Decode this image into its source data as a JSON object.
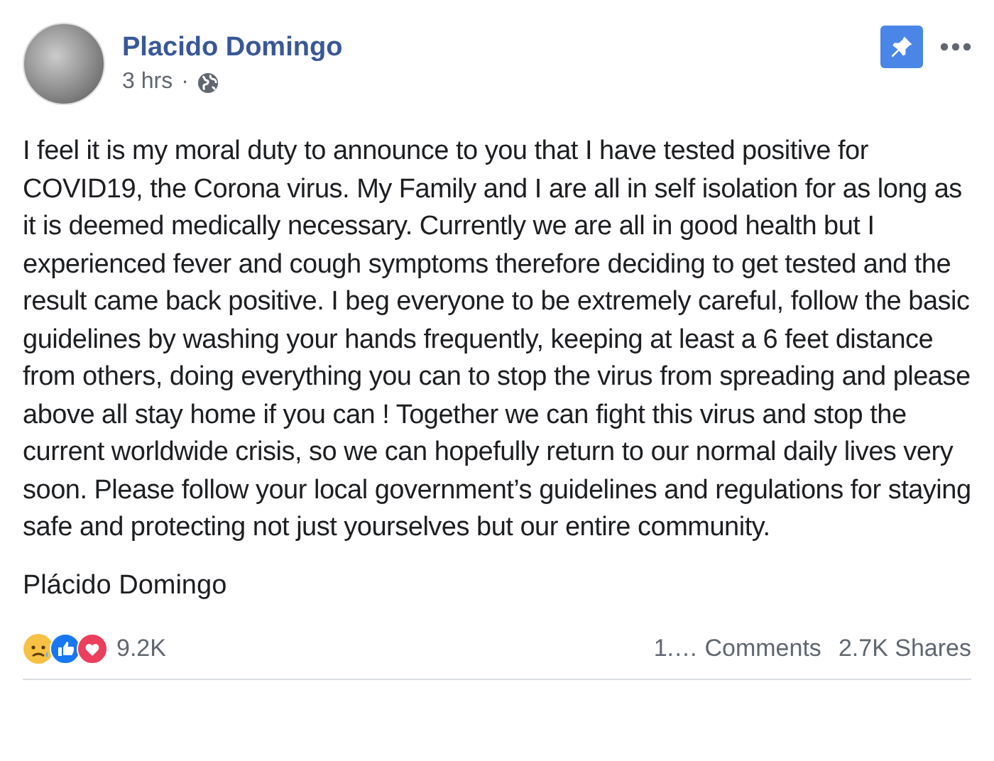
{
  "post": {
    "author": "Placido Domingo",
    "time": "3 hrs",
    "separator": "·",
    "pinned": true,
    "body": "I feel it is my moral duty to announce to you that I have tested positive for COVID19, the Corona virus. My Family and I are all in self isolation for as long as it is deemed medically necessary. Currently we are all in good health but I experienced fever and cough symptoms therefore deciding to get tested and the result came back positive. I beg everyone to be extremely careful, follow the basic guidelines by washing your hands frequently, keeping at least a 6 feet distance from others, doing everything you can to stop the virus from spreading and please above all stay home if you can ! Together we can fight this virus and stop the current worldwide crisis, so we can hopefully return to our normal daily lives very soon. Please follow your local government’s guidelines and regulations for staying safe and protecting not just yourselves but our entire community.",
    "signature": "Plácido Domingo"
  },
  "footer": {
    "reactions_count": "9.2K",
    "comments": "1.… Comments",
    "shares": "2.7K Shares"
  }
}
